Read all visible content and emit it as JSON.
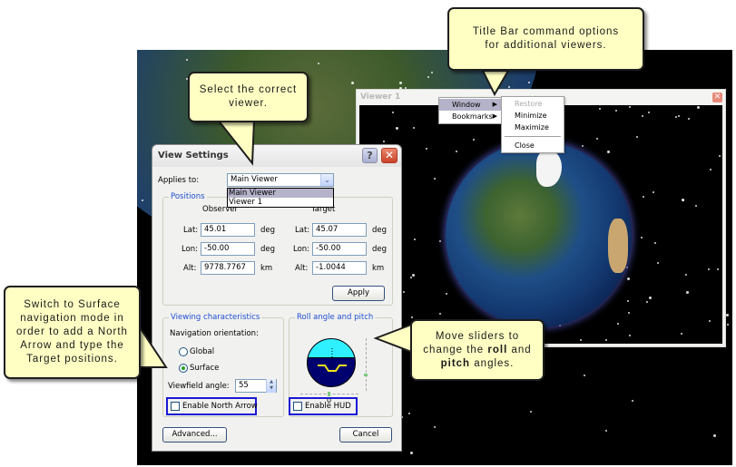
{
  "viewer1": {
    "title": "Viewer 1",
    "close_glyph": "✕",
    "context_menu": {
      "items": [
        {
          "label": "Window",
          "submenu": true,
          "active": true
        },
        {
          "label": "Bookmarks",
          "submenu": true,
          "active": false
        }
      ],
      "submenu_arrow": "▶",
      "window_submenu": [
        {
          "label": "Restore",
          "disabled": true
        },
        {
          "label": "Minimize",
          "disabled": false
        },
        {
          "label": "Maximize",
          "disabled": false
        },
        {
          "label": "Close",
          "disabled": false
        }
      ]
    }
  },
  "dialog": {
    "title": "View Settings",
    "help_glyph": "?",
    "close_glyph": "✕",
    "applies_to": {
      "label": "Applies to:",
      "value": "Main Viewer",
      "dropdown_glyph": "⌄",
      "options": [
        "Main Viewer",
        "Viewer 1"
      ],
      "selected_index": 0
    },
    "positions": {
      "title": "Positions",
      "observer_label": "Observer",
      "target_label": "Target",
      "observer": {
        "lat": {
          "label": "Lat:",
          "value": "45.01",
          "unit": "deg"
        },
        "lon": {
          "label": "Lon:",
          "value": "-50.00",
          "unit": "deg"
        },
        "alt": {
          "label": "Alt:",
          "value": "9778.7767",
          "unit": "km"
        }
      },
      "target": {
        "lat": {
          "label": "Lat:",
          "value": "45.07",
          "unit": "deg"
        },
        "lon": {
          "label": "Lon:",
          "value": "-50.00",
          "unit": "deg"
        },
        "alt": {
          "label": "Alt:",
          "value": "-1.0044",
          "unit": "km"
        }
      },
      "apply_label": "Apply"
    },
    "viewing": {
      "title": "Viewing characteristics",
      "nav_label": "Navigation orientation:",
      "options": [
        {
          "label": "Global",
          "checked": false
        },
        {
          "label": "Surface",
          "checked": true
        }
      ],
      "viewfield_label": "Viewfield angle:",
      "viewfield_value": "55",
      "north_arrow_label": "Enable North Arrow",
      "north_arrow_checked": false
    },
    "roll_pitch": {
      "title": "Roll angle and pitch",
      "roll_value": "0",
      "hud_label": "Enable HUD",
      "hud_checked": false
    },
    "advanced_label": "Advanced...",
    "cancel_label": "Cancel"
  },
  "callouts": {
    "titlebar": "Title Bar command options for additional viewers.",
    "select_viewer": "Select the correct viewer.",
    "surface": "Switch to Surface navigation mode in order to add a North Arrow and type the Target positions.",
    "sliders_pre": "Move sliders to change the ",
    "sliders_roll": "roll",
    "sliders_mid": " and ",
    "sliders_pitch": "pitch",
    "sliders_post": " angles."
  },
  "colors": {
    "callout_bg": "#ffffc4",
    "group_title": "#1f4fd1",
    "highlight_box": "#1919d6",
    "sky": "#2ff0ff",
    "ground": "#00006e"
  }
}
